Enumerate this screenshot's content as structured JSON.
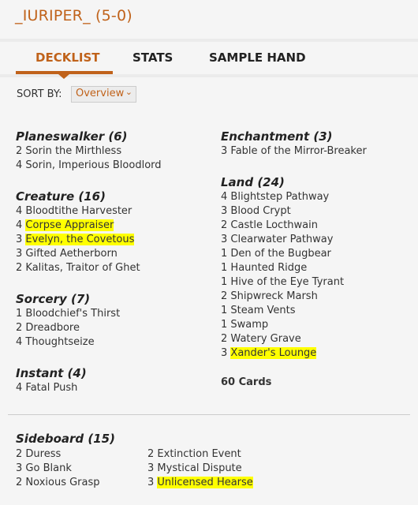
{
  "header": {
    "title": "_IURIPER_ (5-0)"
  },
  "tabs": [
    {
      "label": "DECKLIST",
      "active": true
    },
    {
      "label": "STATS",
      "active": false
    },
    {
      "label": "SAMPLE HAND",
      "active": false
    }
  ],
  "sort": {
    "label": "SORT BY:",
    "selected": "Overview"
  },
  "colors": {
    "accent": "#c0621a",
    "highlight": "#ffff00"
  },
  "left_sections": [
    {
      "title": "Planeswalker (6)",
      "items": [
        {
          "qty": "2",
          "name": "Sorin the Mirthless"
        },
        {
          "qty": "4",
          "name": "Sorin, Imperious Bloodlord"
        }
      ]
    },
    {
      "title": "Creature (16)",
      "items": [
        {
          "qty": "4",
          "name": "Bloodtithe Harvester"
        },
        {
          "qty": "4",
          "name": "Corpse Appraiser",
          "highlight": true
        },
        {
          "qty": "3",
          "name": "Evelyn, the Covetous",
          "highlight": true
        },
        {
          "qty": "3",
          "name": "Gifted Aetherborn"
        },
        {
          "qty": "2",
          "name": "Kalitas, Traitor of Ghet"
        }
      ]
    },
    {
      "title": "Sorcery (7)",
      "items": [
        {
          "qty": "1",
          "name": "Bloodchief's Thirst"
        },
        {
          "qty": "2",
          "name": "Dreadbore"
        },
        {
          "qty": "4",
          "name": "Thoughtseize"
        }
      ]
    },
    {
      "title": "Instant (4)",
      "items": [
        {
          "qty": "4",
          "name": "Fatal Push"
        }
      ]
    }
  ],
  "right_sections": [
    {
      "title": "Enchantment (3)",
      "items": [
        {
          "qty": "3",
          "name": "Fable of the Mirror-Breaker"
        }
      ]
    },
    {
      "title": "Land (24)",
      "items": [
        {
          "qty": "4",
          "name": "Blightstep Pathway"
        },
        {
          "qty": "3",
          "name": "Blood Crypt"
        },
        {
          "qty": "2",
          "name": "Castle Locthwain"
        },
        {
          "qty": "3",
          "name": "Clearwater Pathway"
        },
        {
          "qty": "1",
          "name": "Den of the Bugbear"
        },
        {
          "qty": "1",
          "name": "Haunted Ridge"
        },
        {
          "qty": "1",
          "name": "Hive of the Eye Tyrant"
        },
        {
          "qty": "2",
          "name": "Shipwreck Marsh"
        },
        {
          "qty": "1",
          "name": "Steam Vents"
        },
        {
          "qty": "1",
          "name": "Swamp"
        },
        {
          "qty": "2",
          "name": "Watery Grave"
        },
        {
          "qty": "3",
          "name": "Xander's Lounge",
          "highlight": true
        }
      ]
    }
  ],
  "total": "60 Cards",
  "sideboard": {
    "title": "Sideboard (15)",
    "col1": [
      {
        "qty": "2",
        "name": "Duress"
      },
      {
        "qty": "3",
        "name": "Go Blank"
      },
      {
        "qty": "2",
        "name": "Noxious Grasp"
      }
    ],
    "col2": [
      {
        "qty": "2",
        "name": "Extinction Event"
      },
      {
        "qty": "3",
        "name": "Mystical Dispute"
      },
      {
        "qty": "3",
        "name": "Unlicensed Hearse",
        "highlight": true
      }
    ]
  }
}
